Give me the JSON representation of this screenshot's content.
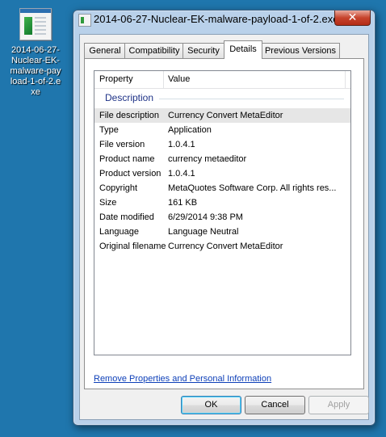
{
  "desktop": {
    "icon_label": "2014-06-27-\nNuclear-EK-\nmalware-pay\nload-1-of-2.e\nxe"
  },
  "window": {
    "title": "2014-06-27-Nuclear-EK-malware-payload-1-of-2.exe ...",
    "close_label": "✕",
    "tabs": [
      {
        "label": "General"
      },
      {
        "label": "Compatibility"
      },
      {
        "label": "Security"
      },
      {
        "label": "Details"
      },
      {
        "label": "Previous Versions"
      }
    ],
    "active_tab": "Details"
  },
  "details": {
    "columns": {
      "property": "Property",
      "value": "Value"
    },
    "group": "Description",
    "rows": [
      {
        "key": "File description",
        "value": "Currency Convert MetaEditor"
      },
      {
        "key": "Type",
        "value": "Application"
      },
      {
        "key": "File version",
        "value": "1.0.4.1"
      },
      {
        "key": "Product name",
        "value": "currency metaeditor"
      },
      {
        "key": "Product version",
        "value": "1.0.4.1"
      },
      {
        "key": "Copyright",
        "value": "MetaQuotes Software Corp. All rights res..."
      },
      {
        "key": "Size",
        "value": "161 KB"
      },
      {
        "key": "Date modified",
        "value": "6/29/2014 9:38 PM"
      },
      {
        "key": "Language",
        "value": "Language Neutral"
      },
      {
        "key": "Original filename",
        "value": "Currency Convert MetaEditor"
      }
    ],
    "remove_link": "Remove Properties and Personal Information"
  },
  "buttons": {
    "ok": "OK",
    "cancel": "Cancel",
    "apply": "Apply"
  }
}
